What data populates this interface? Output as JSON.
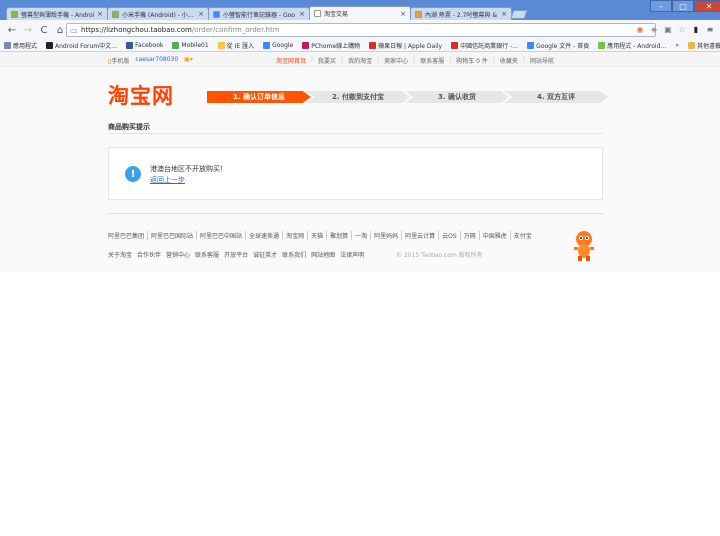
{
  "tabs": [
    {
      "title": "螢幕型與薄殼手機 - Androi",
      "color": "#7cc142"
    },
    {
      "title": "小米手機 (Android) - 小螢幕",
      "color": "#7cc142"
    },
    {
      "title": "小螢智能行車記錄器 - Goo",
      "color": "#4285f4"
    },
    {
      "title": "淘宝交易",
      "color": "#ffffff"
    },
    {
      "title": "內湖 熱賣 - 2.7吋螢幕與 &",
      "color": "#e8a33d"
    }
  ],
  "window": {
    "minimize": "–",
    "maximize": "□",
    "close": "✕"
  },
  "address": {
    "host": "https://lizhongchou.taobao.com",
    "path": "/order/confirm_order.htm"
  },
  "bookmarks": [
    {
      "label": "應用程式",
      "color": "#7a8aa0"
    },
    {
      "label": "Android Forum中文…",
      "color": "#222222"
    },
    {
      "label": "Facebook",
      "color": "#3b5998"
    },
    {
      "label": "Mobile01",
      "color": "#4caf50"
    },
    {
      "label": "從 IE 匯入",
      "color": "#f3c94a"
    },
    {
      "label": "Google",
      "color": "#4285f4"
    },
    {
      "label": "PChome線上購物",
      "color": "#c2185b"
    },
    {
      "label": "蘋果日報 | Apple Daily",
      "color": "#d32f2f"
    },
    {
      "label": "中國信託商業銀行 -…",
      "color": "#d32f2f"
    },
    {
      "label": "Google 文件 - 首頁",
      "color": "#4285f4"
    },
    {
      "label": "應用程式 - Android…",
      "color": "#7cc142"
    }
  ],
  "bookmarks_more": "»",
  "bookmarks_other": "其他書籤",
  "sitebar": {
    "mobile": "手机版",
    "user": "caesar708030",
    "links": [
      "淘宝网首页",
      "我要买",
      "我的淘宝",
      "卖家中心",
      "联系客服",
      "购物车 0 件",
      "收藏夹",
      "网站导航"
    ]
  },
  "logo": "淘宝网",
  "steps": [
    "1. 确认订单信息",
    "2. 付款到支付宝",
    "3. 确认收货",
    "4. 双方互评"
  ],
  "active_step": 0,
  "section_title": "商品购买提示",
  "notice": {
    "icon": "!",
    "message": "港澳台地区不开放购买！",
    "back_link": "返回上一步"
  },
  "footer_links1": [
    "阿里巴巴集团",
    "阿里巴巴国际站",
    "阿里巴巴中国站",
    "全球速卖通",
    "淘宝网",
    "天猫",
    "聚划算",
    "一淘",
    "阿里妈妈",
    "阿里云计算",
    "云OS",
    "万网",
    "中国雅虎",
    "支付宝"
  ],
  "footer_links2": [
    "关于淘宝",
    "合作伙伴",
    "营销中心",
    "联系客服",
    "开放平台",
    "诚征英才",
    "联系我们",
    "网站地图",
    "法律声明"
  ],
  "copyright": "© 2015 Taobao.com 版权所有"
}
